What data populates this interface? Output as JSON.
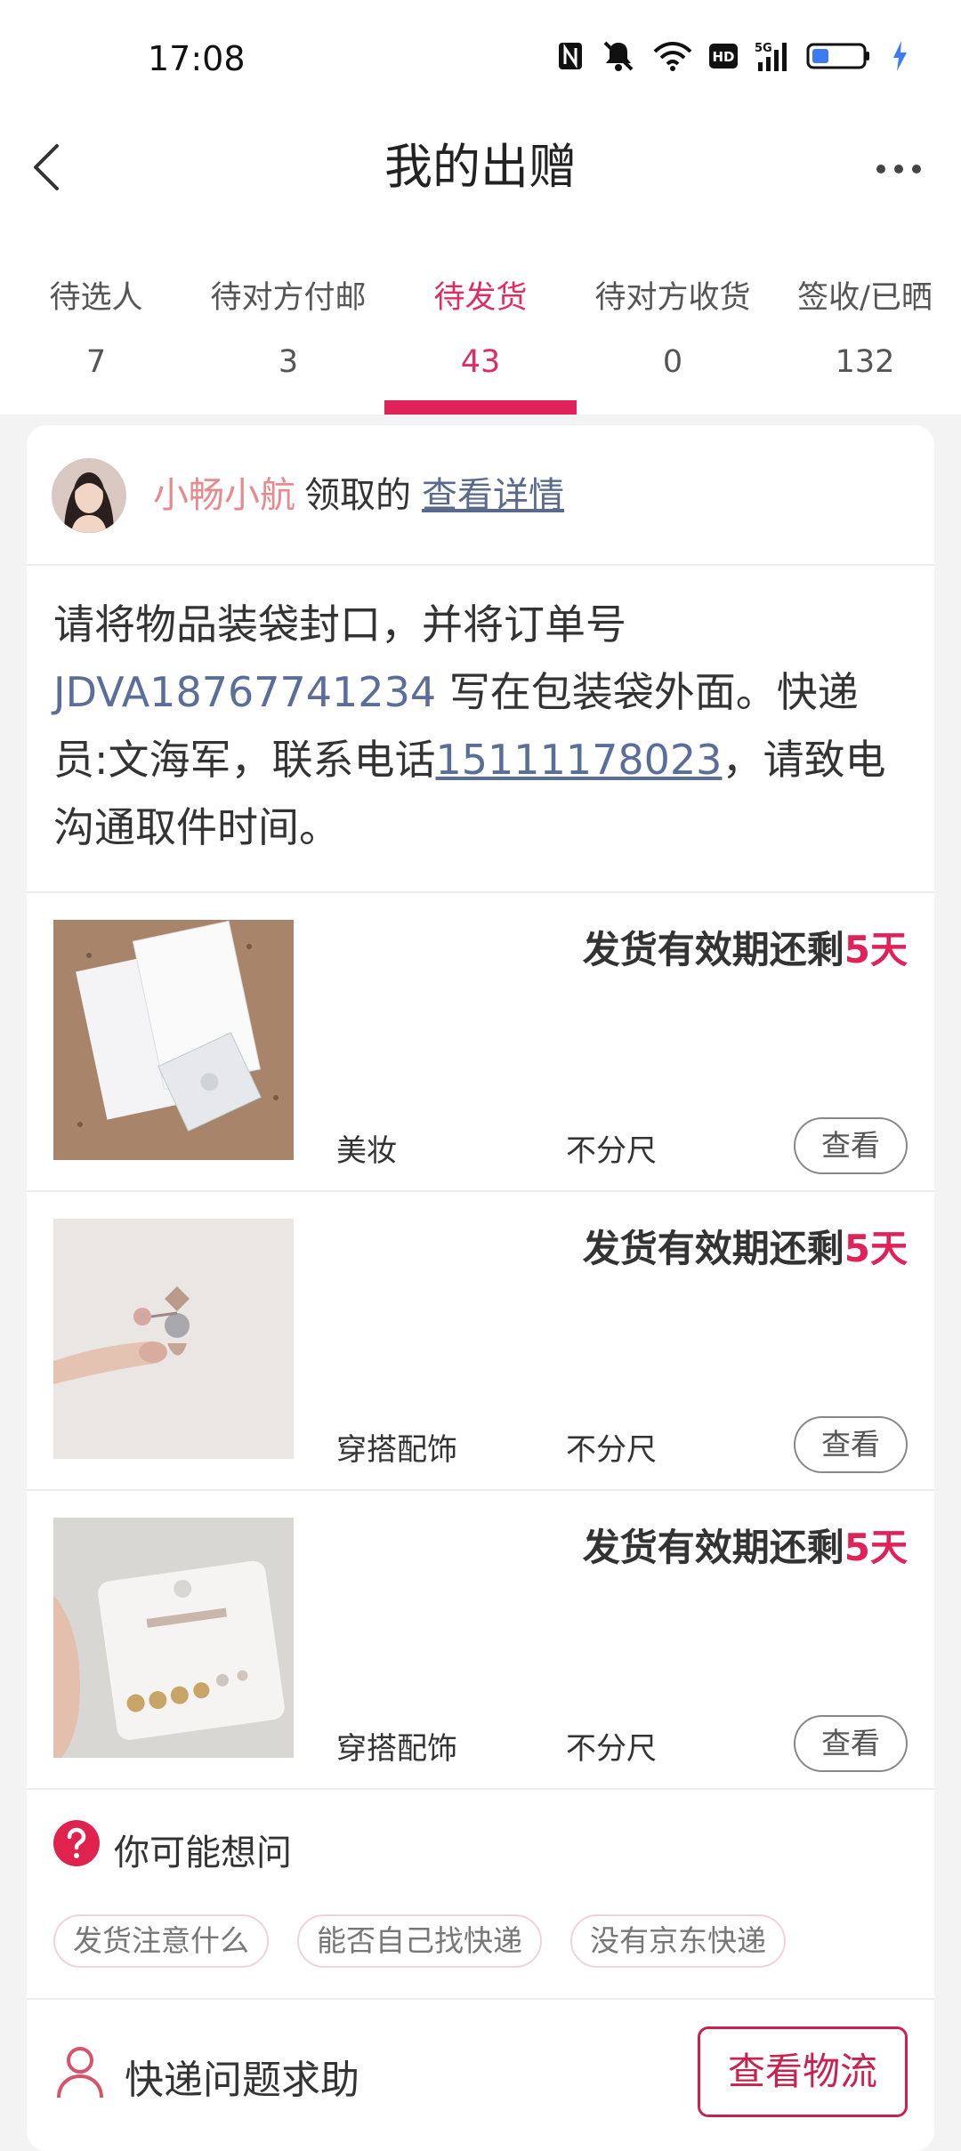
{
  "status_bar": {
    "time": "17:08"
  },
  "header": {
    "title": "我的出赠"
  },
  "tabs": [
    {
      "label": "待选人",
      "count": "7"
    },
    {
      "label": "待对方付邮",
      "count": "3"
    },
    {
      "label": "待发货",
      "count": "43"
    },
    {
      "label": "待对方收货",
      "count": "0"
    },
    {
      "label": "签收/已晒",
      "count": "132"
    }
  ],
  "receiver": {
    "name": "小畅小航",
    "suffix": "领取的",
    "detail_link": "查看详情"
  },
  "instruction": {
    "part1": "请将物品装袋封口，并将订单号 ",
    "order_no": "JDVA18767741234",
    "part2": " 写在包装袋外面。快递员:文海军，联系电话",
    "phone": "15111178023",
    "part3": "，请致电沟通取件时间。"
  },
  "items": [
    {
      "deadline_prefix": "发货有效期还剩",
      "deadline_days": "5天",
      "category": "美妆",
      "size": "不分尺",
      "view_label": "查看"
    },
    {
      "deadline_prefix": "发货有效期还剩",
      "deadline_days": "5天",
      "category": "穿搭配饰",
      "size": "不分尺",
      "view_label": "查看"
    },
    {
      "deadline_prefix": "发货有效期还剩",
      "deadline_days": "5天",
      "category": "穿搭配饰",
      "size": "不分尺",
      "view_label": "查看"
    }
  ],
  "faq": {
    "title": "你可能想问",
    "chips": [
      "发货注意什么",
      "能否自己找快递",
      "没有京东快递"
    ]
  },
  "help": {
    "label": "快递问题求助",
    "logistics_button": "查看物流"
  },
  "colors": {
    "accent": "#e0225a",
    "link": "#5a6e99",
    "receiver_name": "#e68a8f"
  }
}
